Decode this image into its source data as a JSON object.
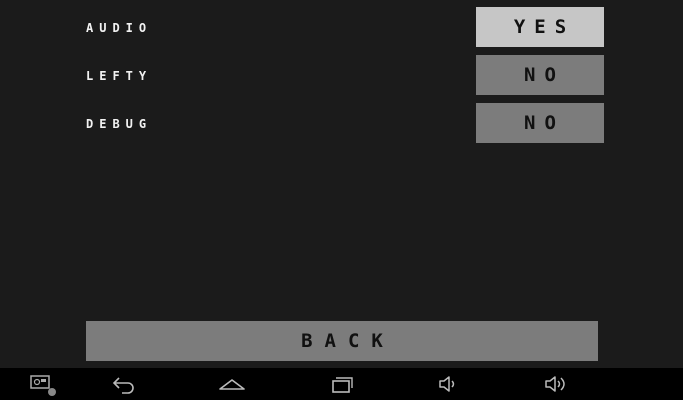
{
  "settings": {
    "audio": {
      "label": "AUDIO",
      "value": "YES"
    },
    "lefty": {
      "label": "LEFTY",
      "value": "NO"
    },
    "debug": {
      "label": "DEBUG",
      "value": "NO"
    }
  },
  "back_label": "BACK",
  "navbar": {
    "icons": [
      "screenshot-icon",
      "back-arrow-icon",
      "home-icon",
      "recent-apps-icon",
      "volume-down-icon",
      "volume-up-icon"
    ]
  },
  "colors": {
    "background": "#1b1b1b",
    "toggle_on": "#c6c6c6",
    "toggle_off": "#7c7c7c",
    "label_text": "#f2f2f2",
    "navbar": "#000000"
  }
}
